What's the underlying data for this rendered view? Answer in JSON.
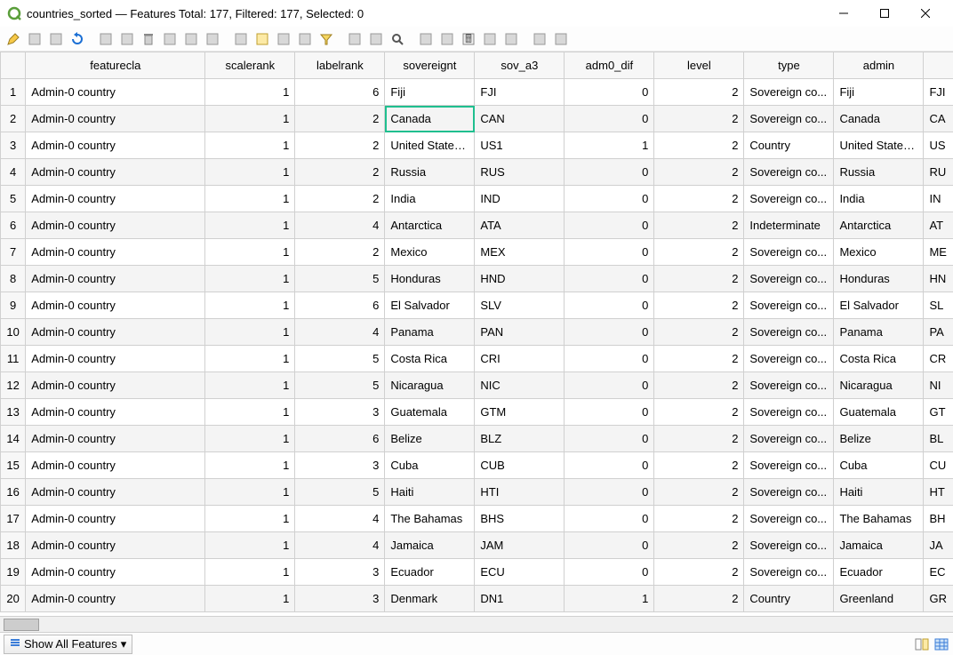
{
  "window": {
    "title": "countries_sorted — Features Total: 177, Filtered: 177, Selected: 0"
  },
  "statusbar": {
    "show_all_label": "Show All Features"
  },
  "selected_cell": {
    "row_index": 2,
    "col_key": "sovereignt"
  },
  "columns": [
    {
      "key": "featurecla",
      "label": "featurecla",
      "align": "txt"
    },
    {
      "key": "scalerank",
      "label": "scalerank",
      "align": "num"
    },
    {
      "key": "labelrank",
      "label": "labelrank",
      "align": "num"
    },
    {
      "key": "sovereignt",
      "label": "sovereignt",
      "align": "txt"
    },
    {
      "key": "sov_a3",
      "label": "sov_a3",
      "align": "txt"
    },
    {
      "key": "adm0_dif",
      "label": "adm0_dif",
      "align": "num"
    },
    {
      "key": "level",
      "label": "level",
      "align": "num"
    },
    {
      "key": "type",
      "label": "type",
      "align": "txt"
    },
    {
      "key": "admin",
      "label": "admin",
      "align": "txt"
    },
    {
      "key": "adm0_a3",
      "label": "",
      "align": "txt"
    }
  ],
  "rows": [
    {
      "n": 1,
      "featurecla": "Admin-0 country",
      "scalerank": 1,
      "labelrank": 6,
      "sovereignt": "Fiji",
      "sov_a3": "FJI",
      "adm0_dif": 0,
      "level": 2,
      "type": "Sovereign co...",
      "admin": "Fiji",
      "adm0_a3": "FJI"
    },
    {
      "n": 2,
      "featurecla": "Admin-0 country",
      "scalerank": 1,
      "labelrank": 2,
      "sovereignt": "Canada",
      "sov_a3": "CAN",
      "adm0_dif": 0,
      "level": 2,
      "type": "Sovereign co...",
      "admin": "Canada",
      "adm0_a3": "CA"
    },
    {
      "n": 3,
      "featurecla": "Admin-0 country",
      "scalerank": 1,
      "labelrank": 2,
      "sovereignt": "United States...",
      "sov_a3": "US1",
      "adm0_dif": 1,
      "level": 2,
      "type": "Country",
      "admin": "United States...",
      "adm0_a3": "US"
    },
    {
      "n": 4,
      "featurecla": "Admin-0 country",
      "scalerank": 1,
      "labelrank": 2,
      "sovereignt": "Russia",
      "sov_a3": "RUS",
      "adm0_dif": 0,
      "level": 2,
      "type": "Sovereign co...",
      "admin": "Russia",
      "adm0_a3": "RU"
    },
    {
      "n": 5,
      "featurecla": "Admin-0 country",
      "scalerank": 1,
      "labelrank": 2,
      "sovereignt": "India",
      "sov_a3": "IND",
      "adm0_dif": 0,
      "level": 2,
      "type": "Sovereign co...",
      "admin": "India",
      "adm0_a3": "IN"
    },
    {
      "n": 6,
      "featurecla": "Admin-0 country",
      "scalerank": 1,
      "labelrank": 4,
      "sovereignt": "Antarctica",
      "sov_a3": "ATA",
      "adm0_dif": 0,
      "level": 2,
      "type": "Indeterminate",
      "admin": "Antarctica",
      "adm0_a3": "AT"
    },
    {
      "n": 7,
      "featurecla": "Admin-0 country",
      "scalerank": 1,
      "labelrank": 2,
      "sovereignt": "Mexico",
      "sov_a3": "MEX",
      "adm0_dif": 0,
      "level": 2,
      "type": "Sovereign co...",
      "admin": "Mexico",
      "adm0_a3": "ME"
    },
    {
      "n": 8,
      "featurecla": "Admin-0 country",
      "scalerank": 1,
      "labelrank": 5,
      "sovereignt": "Honduras",
      "sov_a3": "HND",
      "adm0_dif": 0,
      "level": 2,
      "type": "Sovereign co...",
      "admin": "Honduras",
      "adm0_a3": "HN"
    },
    {
      "n": 9,
      "featurecla": "Admin-0 country",
      "scalerank": 1,
      "labelrank": 6,
      "sovereignt": "El Salvador",
      "sov_a3": "SLV",
      "adm0_dif": 0,
      "level": 2,
      "type": "Sovereign co...",
      "admin": "El Salvador",
      "adm0_a3": "SL"
    },
    {
      "n": 10,
      "featurecla": "Admin-0 country",
      "scalerank": 1,
      "labelrank": 4,
      "sovereignt": "Panama",
      "sov_a3": "PAN",
      "adm0_dif": 0,
      "level": 2,
      "type": "Sovereign co...",
      "admin": "Panama",
      "adm0_a3": "PA"
    },
    {
      "n": 11,
      "featurecla": "Admin-0 country",
      "scalerank": 1,
      "labelrank": 5,
      "sovereignt": "Costa Rica",
      "sov_a3": "CRI",
      "adm0_dif": 0,
      "level": 2,
      "type": "Sovereign co...",
      "admin": "Costa Rica",
      "adm0_a3": "CR"
    },
    {
      "n": 12,
      "featurecla": "Admin-0 country",
      "scalerank": 1,
      "labelrank": 5,
      "sovereignt": "Nicaragua",
      "sov_a3": "NIC",
      "adm0_dif": 0,
      "level": 2,
      "type": "Sovereign co...",
      "admin": "Nicaragua",
      "adm0_a3": "NI"
    },
    {
      "n": 13,
      "featurecla": "Admin-0 country",
      "scalerank": 1,
      "labelrank": 3,
      "sovereignt": "Guatemala",
      "sov_a3": "GTM",
      "adm0_dif": 0,
      "level": 2,
      "type": "Sovereign co...",
      "admin": "Guatemala",
      "adm0_a3": "GT"
    },
    {
      "n": 14,
      "featurecla": "Admin-0 country",
      "scalerank": 1,
      "labelrank": 6,
      "sovereignt": "Belize",
      "sov_a3": "BLZ",
      "adm0_dif": 0,
      "level": 2,
      "type": "Sovereign co...",
      "admin": "Belize",
      "adm0_a3": "BL"
    },
    {
      "n": 15,
      "featurecla": "Admin-0 country",
      "scalerank": 1,
      "labelrank": 3,
      "sovereignt": "Cuba",
      "sov_a3": "CUB",
      "adm0_dif": 0,
      "level": 2,
      "type": "Sovereign co...",
      "admin": "Cuba",
      "adm0_a3": "CU"
    },
    {
      "n": 16,
      "featurecla": "Admin-0 country",
      "scalerank": 1,
      "labelrank": 5,
      "sovereignt": "Haiti",
      "sov_a3": "HTI",
      "adm0_dif": 0,
      "level": 2,
      "type": "Sovereign co...",
      "admin": "Haiti",
      "adm0_a3": "HT"
    },
    {
      "n": 17,
      "featurecla": "Admin-0 country",
      "scalerank": 1,
      "labelrank": 4,
      "sovereignt": "The Bahamas",
      "sov_a3": "BHS",
      "adm0_dif": 0,
      "level": 2,
      "type": "Sovereign co...",
      "admin": "The Bahamas",
      "adm0_a3": "BH"
    },
    {
      "n": 18,
      "featurecla": "Admin-0 country",
      "scalerank": 1,
      "labelrank": 4,
      "sovereignt": "Jamaica",
      "sov_a3": "JAM",
      "adm0_dif": 0,
      "level": 2,
      "type": "Sovereign co...",
      "admin": "Jamaica",
      "adm0_a3": "JA"
    },
    {
      "n": 19,
      "featurecla": "Admin-0 country",
      "scalerank": 1,
      "labelrank": 3,
      "sovereignt": "Ecuador",
      "sov_a3": "ECU",
      "adm0_dif": 0,
      "level": 2,
      "type": "Sovereign co...",
      "admin": "Ecuador",
      "adm0_a3": "EC"
    },
    {
      "n": 20,
      "featurecla": "Admin-0 country",
      "scalerank": 1,
      "labelrank": 3,
      "sovereignt": "Denmark",
      "sov_a3": "DN1",
      "adm0_dif": 1,
      "level": 2,
      "type": "Country",
      "admin": "Greenland",
      "adm0_a3": "GR"
    }
  ],
  "toolbar_icons": [
    "edit-pencil-icon",
    "save-edits-icon",
    "add-feature-icon",
    "reload-icon",
    "copy-icon",
    "paste-icon",
    "delete-icon",
    "cut-icon",
    "undo-icon",
    "redo-icon",
    "select-by-expression-icon",
    "select-all-icon",
    "invert-selection-icon",
    "deselect-icon",
    "filter-icon",
    "move-selection-top-icon",
    "pan-to-selected-icon",
    "zoom-to-selected-icon",
    "new-field-icon",
    "delete-field-icon",
    "field-calculator-icon",
    "conditional-formatting-icon",
    "actions-icon",
    "dock-icon",
    "form-view-icon"
  ]
}
